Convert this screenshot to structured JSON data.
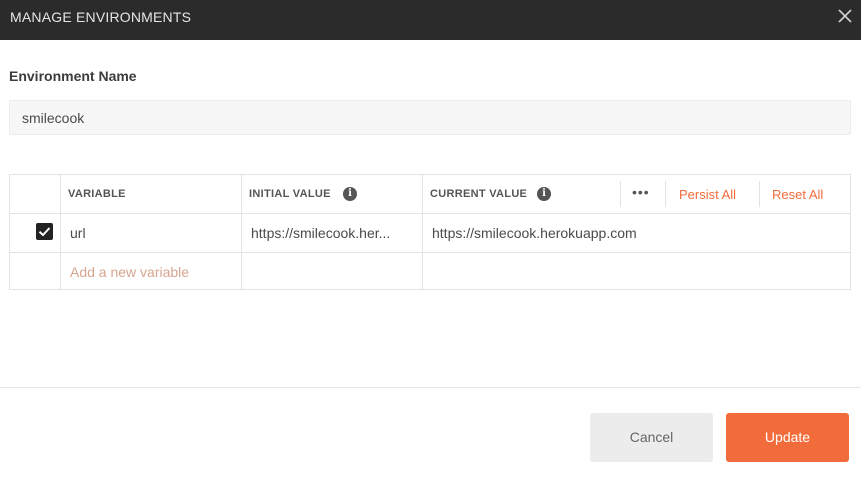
{
  "dialog": {
    "title": "MANAGE ENVIRONMENTS"
  },
  "environment": {
    "label": "Environment Name",
    "name": "smilecook"
  },
  "table": {
    "headers": {
      "variable": "VARIABLE",
      "initial_value": "INITIAL VALUE",
      "current_value": "CURRENT VALUE"
    },
    "info_icon": "i",
    "more_label": "•••",
    "persist_all": "Persist All",
    "reset_all": "Reset All",
    "rows": [
      {
        "checked": true,
        "variable": "url",
        "initial_value": "https://smilecook.her...",
        "current_value": "https://smilecook.herokuapp.com"
      }
    ],
    "add_placeholder": "Add a new variable"
  },
  "buttons": {
    "cancel": "Cancel",
    "update": "Update"
  },
  "colors": {
    "accent": "#f26b3a",
    "titlebar": "#2b2b2b"
  }
}
